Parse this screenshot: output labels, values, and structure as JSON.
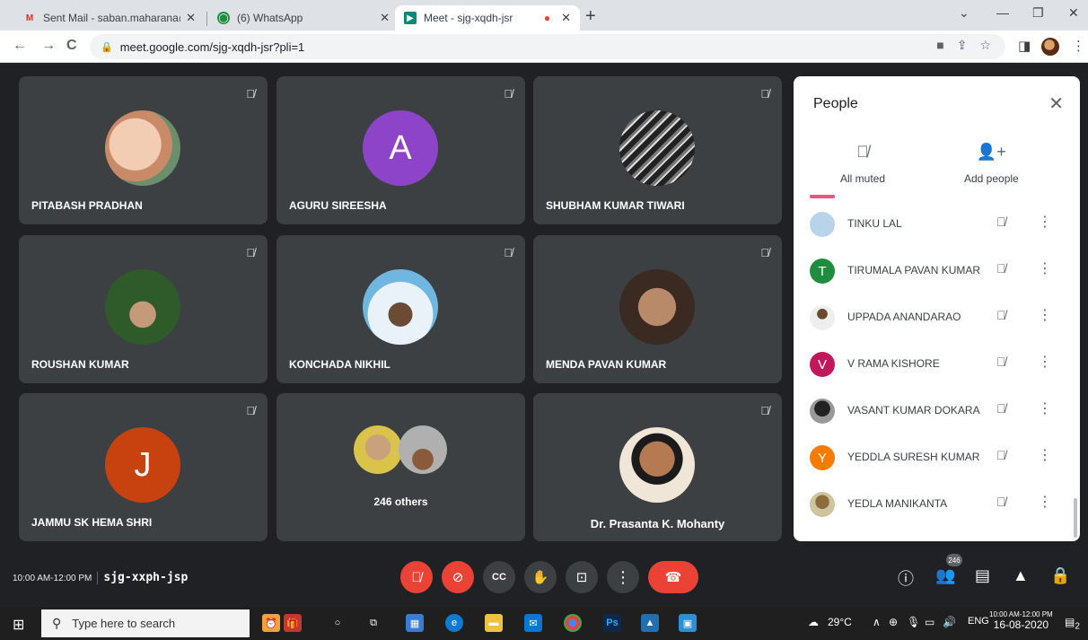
{
  "browser": {
    "tabs": [
      {
        "title": "Sent Mail - saban.maharana@cu",
        "favicon": "gmail-icon"
      },
      {
        "title": "(6) WhatsApp",
        "favicon": "whatsapp-icon"
      },
      {
        "title": "Meet - sjg-xqdh-jsr",
        "favicon": "meet-icon",
        "active": true
      }
    ],
    "url": "meet.google.com/sjg-xqdh-jsr?pli=1"
  },
  "tiles": [
    {
      "name": "PITABASH PRADHAN",
      "avatar": "photo-baby"
    },
    {
      "name": "AGURU SIREESHA",
      "avatar_letter": "A",
      "color": "#8e44c9"
    },
    {
      "name": "SHUBHAM KUMAR TIWARI",
      "avatar": "photo-laptop"
    },
    {
      "name": "ROUSHAN KUMAR",
      "avatar": "photo-garden"
    },
    {
      "name": "KONCHADA NIKHIL",
      "avatar": "photo-sky"
    },
    {
      "name": "MENDA PAVAN KUMAR",
      "avatar": "photo-man-glasses"
    },
    {
      "name": "JAMMU SK HEMA SHRI",
      "avatar_letter": "J",
      "color": "#c8420f"
    },
    {
      "name": "246 others",
      "avatar": "photo-group"
    },
    {
      "name": "Dr. Prasanta K. Mohanty",
      "avatar": "photo-presenter"
    }
  ],
  "people_panel": {
    "title": "People",
    "all_muted": "All muted",
    "add_people": "Add people",
    "participants": [
      {
        "name": "TINKU LAL",
        "avatar": "photo",
        "color": "#b9d4ea"
      },
      {
        "name": "TIRUMALA PAVAN KUMAR",
        "letter": "T",
        "color": "#1e8e3e"
      },
      {
        "name": "UPPADA ANANDARAO",
        "avatar": "photo",
        "color": "#6b4a2f"
      },
      {
        "name": "V RAMA KISHORE",
        "letter": "V",
        "color": "#c2185b"
      },
      {
        "name": "VASANT KUMAR DOKARA",
        "avatar": "photo",
        "color": "#444444"
      },
      {
        "name": "YEDDLA SURESH KUMAR",
        "letter": "Y",
        "color": "#f57c00"
      },
      {
        "name": "YEDLA MANIKANTA",
        "avatar": "photo",
        "color": "#8a6d3b"
      }
    ]
  },
  "meeting": {
    "time": "10:00 AM-12:00 PM",
    "code": "sjg-xxph-jsp",
    "participant_count": "246"
  },
  "taskbar": {
    "search_placeholder": "Type here to search",
    "weather": "29°C",
    "language": "ENG",
    "clock_time": "10:00 AM-12:00 PM",
    "clock_date": "16-08-2020",
    "notifications": "2"
  }
}
